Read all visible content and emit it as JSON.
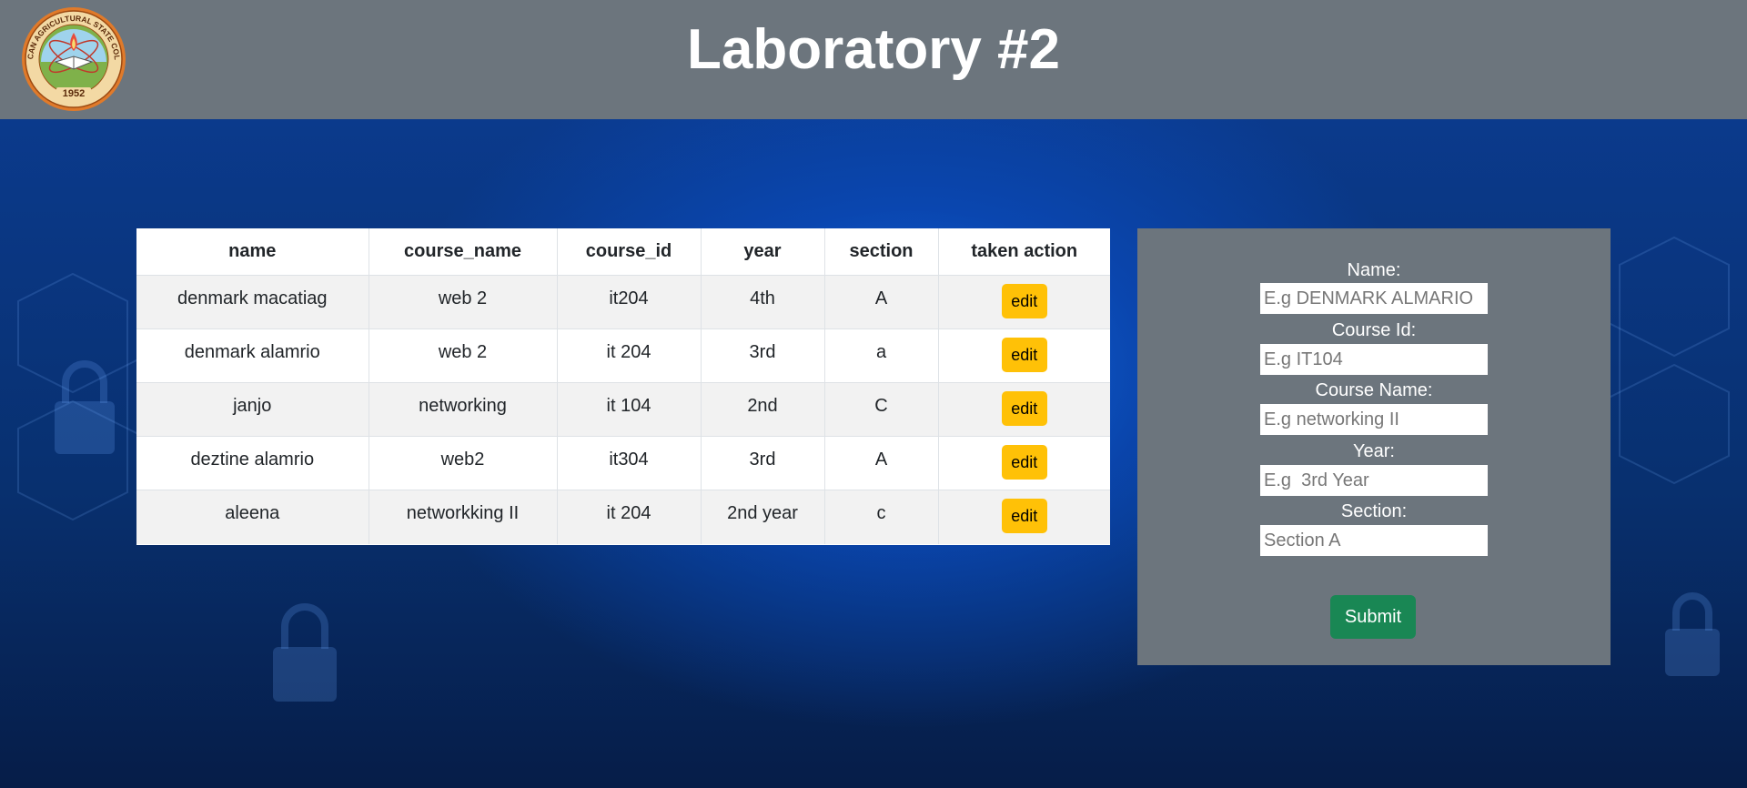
{
  "header": {
    "title": "Laboratory #2",
    "logo": {
      "text_top": "BULACAN AGRICULTURAL STATE COLLEGE",
      "year": "1952"
    }
  },
  "table": {
    "columns": [
      "name",
      "course_name",
      "course_id",
      "year",
      "section",
      "taken action"
    ],
    "rows": [
      {
        "name": "denmark macatiag",
        "course_name": "web 2",
        "course_id": "it204",
        "year": "4th",
        "section": "A",
        "action": "edit"
      },
      {
        "name": "denmark alamrio",
        "course_name": "web 2",
        "course_id": "it 204",
        "year": "3rd",
        "section": "a",
        "action": "edit"
      },
      {
        "name": "janjo",
        "course_name": "networking",
        "course_id": "it 104",
        "year": "2nd",
        "section": "C",
        "action": "edit"
      },
      {
        "name": "deztine alamrio",
        "course_name": "web2",
        "course_id": "it304",
        "year": "3rd",
        "section": "A",
        "action": "edit"
      },
      {
        "name": "aleena",
        "course_name": "networkking II",
        "course_id": "it 204",
        "year": "2nd year",
        "section": "c",
        "action": "edit"
      }
    ]
  },
  "form": {
    "name_label": "Name:",
    "name_placeholder": "E.g DENMARK ALMARIO",
    "course_id_label": "Course Id:",
    "course_id_placeholder": "E.g IT104",
    "course_name_label": "Course Name:",
    "course_name_placeholder": "E.g networking II",
    "year_label": "Year:",
    "year_placeholder": "E.g  3rd Year",
    "section_label": "Section:",
    "section_placeholder": "Section A",
    "submit_label": "Submit"
  },
  "colors": {
    "header_bg": "#6c757d",
    "edit_button": "#ffc107",
    "submit_button": "#198754",
    "form_panel": "#6c757d"
  },
  "icons": [
    "college-seal-logo",
    "padlock-icon"
  ]
}
